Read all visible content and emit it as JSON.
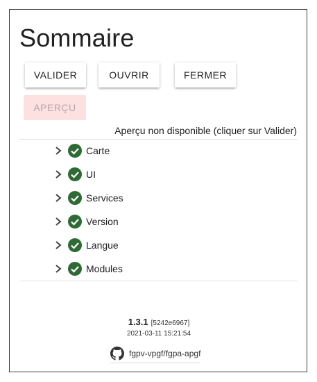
{
  "title": "Sommaire",
  "buttons": {
    "valider": "VALIDER",
    "ouvrir": "OUVRIR",
    "fermer": "FERMER",
    "apercu": "APERÇU"
  },
  "status_message": "Aperçu non disponible (cliquer sur Valider)",
  "tree_items": [
    {
      "label": "Carte",
      "status": "check-icon"
    },
    {
      "label": "UI",
      "status": "check-icon"
    },
    {
      "label": "Services",
      "status": "check-icon"
    },
    {
      "label": "Version",
      "status": "check-icon"
    },
    {
      "label": "Langue",
      "status": "check-icon"
    },
    {
      "label": "Modules",
      "status": "check-icon"
    }
  ],
  "version": {
    "number": "1.3.1",
    "hash": "[5242e6967]",
    "date": "2021-03-11 15:21:54"
  },
  "repo": {
    "icon": "github-icon",
    "label": "fgpv-vpgf/fgpa-apgf"
  },
  "colors": {
    "check": "#2e6b34",
    "disabled_bg": "#fde0e0",
    "disabled_text": "#b9a6a6"
  }
}
